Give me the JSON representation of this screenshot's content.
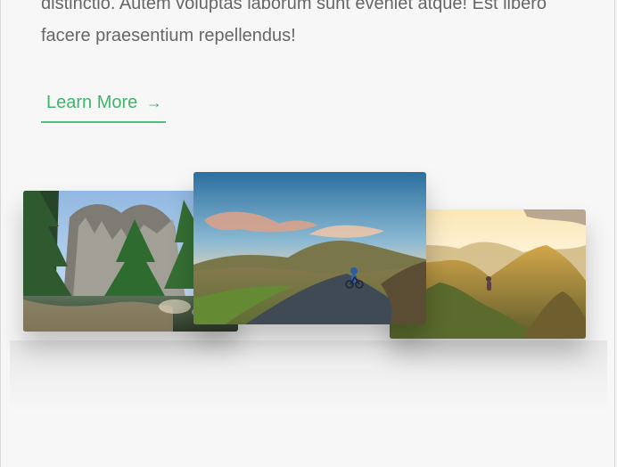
{
  "intro": {
    "line_1": "distinctio. Autem voluptas laborum sunt eveniet atque! Est libero",
    "line_2": "facere praesentium repellendus!"
  },
  "cta": {
    "label": "Learn More",
    "arrow": "→",
    "color": "#41b36b"
  },
  "images": [
    {
      "name": "forest-lake-photo"
    },
    {
      "name": "cyclist-road-photo"
    },
    {
      "name": "mountain-ridge-photo"
    }
  ]
}
